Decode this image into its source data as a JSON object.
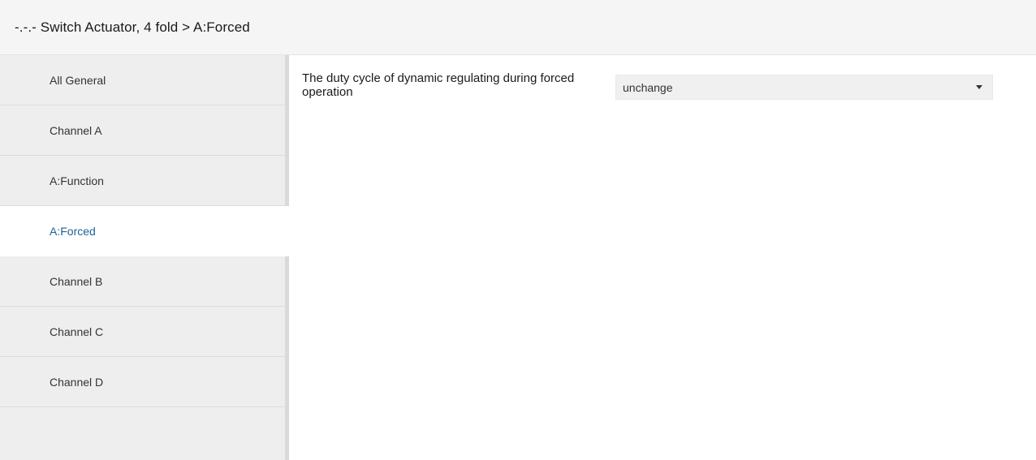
{
  "header": {
    "title": "-.-.- Switch Actuator, 4 fold > A:Forced"
  },
  "sidebar": {
    "items": [
      {
        "label": "All General",
        "active": false
      },
      {
        "label": "Channel A",
        "active": false
      },
      {
        "label": "A:Function",
        "active": false
      },
      {
        "label": "A:Forced",
        "active": true
      },
      {
        "label": "Channel B",
        "active": false
      },
      {
        "label": "Channel C",
        "active": false
      },
      {
        "label": "Channel D",
        "active": false
      }
    ]
  },
  "main": {
    "parameter": {
      "label": "The duty cycle of dynamic regulating during forced operation",
      "selected_value": "unchange"
    }
  },
  "colors": {
    "active_nav_text": "#1f5f99",
    "nav_background": "#eeeeee",
    "header_background": "#f5f5f5"
  }
}
